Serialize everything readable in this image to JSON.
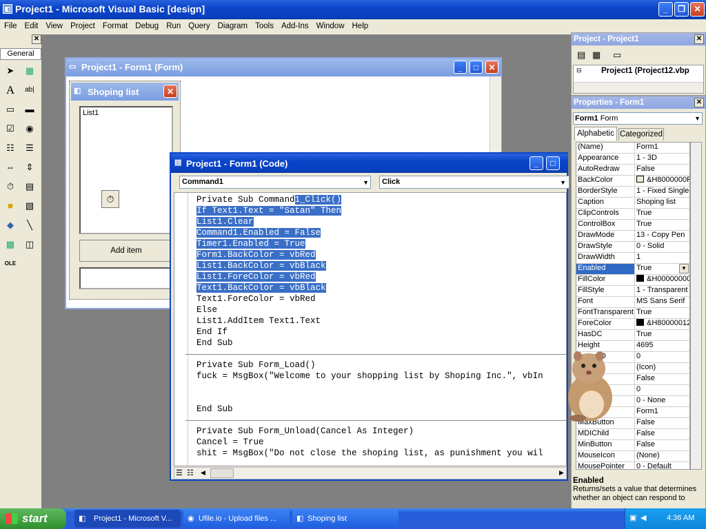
{
  "main_window": {
    "title": "Project1 - Microsoft Visual Basic [design]"
  },
  "menu": [
    "File",
    "Edit",
    "View",
    "Project",
    "Format",
    "Debug",
    "Run",
    "Query",
    "Diagram",
    "Tools",
    "Add-Ins",
    "Window",
    "Help"
  ],
  "toolbox": {
    "tab": "General"
  },
  "form_designer": {
    "title": "Project1 - Form1 (Form)"
  },
  "form1": {
    "title": "Shoping list",
    "list_label": "List1",
    "button_label": "Add item"
  },
  "code_window": {
    "title": "Project1 - Form1 (Code)",
    "object_dropdown": "Command1",
    "proc_dropdown": "Click",
    "sections": [
      [
        {
          "pre": "Private Sub Command",
          "sel": "1_Click()"
        },
        {
          "pre": "",
          "sel": "If Text1.Text = \"Satan\" Then"
        },
        {
          "pre": "",
          "sel": "List1.Clear"
        },
        {
          "pre": "",
          "sel": "Command1.Enabled = False"
        },
        {
          "pre": "",
          "sel": "Timer1.Enabled = True"
        },
        {
          "pre": "",
          "sel": "Form1.BackColor = vbRed"
        },
        {
          "pre": "",
          "sel": "List1.BackColor = vbBlack"
        },
        {
          "pre": "",
          "sel": "List1.ForeColor = vbRed"
        },
        {
          "pre": "",
          "sel": "Text1.BackColor = vbBlack"
        },
        {
          "pre": "Text1.ForeColor = vbRed",
          "sel": ""
        },
        {
          "pre": "Else",
          "sel": ""
        },
        {
          "pre": "List1.AddItem Text1.Text",
          "sel": ""
        },
        {
          "pre": "End If",
          "sel": ""
        },
        {
          "pre": "End Sub",
          "sel": ""
        }
      ],
      [
        {
          "pre": "Private Sub Form_Load()",
          "sel": ""
        },
        {
          "pre": "fuck = MsgBox(\"Welcome to your shopping list by Shoping Inc.\", vbIn",
          "sel": ""
        },
        {
          "pre": "",
          "sel": ""
        },
        {
          "pre": "",
          "sel": ""
        },
        {
          "pre": "End Sub",
          "sel": ""
        }
      ],
      [
        {
          "pre": "Private Sub Form_Unload(Cancel As Integer)",
          "sel": ""
        },
        {
          "pre": "Cancel = True",
          "sel": ""
        },
        {
          "pre": "shit = MsgBox(\"Do not close the shoping list, as punishment you wil",
          "sel": ""
        }
      ]
    ]
  },
  "project_panel": {
    "title": "Project - Project1",
    "tree_item": "Project1 (Project12.vbp"
  },
  "properties_panel": {
    "title": "Properties - Form1",
    "object_name": "Form1",
    "object_type": "Form",
    "tabs": [
      "Alphabetic",
      "Categorized"
    ],
    "rows": [
      {
        "k": "(Name)",
        "v": "Form1"
      },
      {
        "k": "Appearance",
        "v": "1 - 3D"
      },
      {
        "k": "AutoRedraw",
        "v": "False"
      },
      {
        "k": "BackColor",
        "v": "&H8000000F",
        "swatch": "#ece9d8"
      },
      {
        "k": "BorderStyle",
        "v": "1 - Fixed Single"
      },
      {
        "k": "Caption",
        "v": "Shoping list"
      },
      {
        "k": "ClipControls",
        "v": "True"
      },
      {
        "k": "ControlBox",
        "v": "True"
      },
      {
        "k": "DrawMode",
        "v": "13 - Copy Pen"
      },
      {
        "k": "DrawStyle",
        "v": "0 - Solid"
      },
      {
        "k": "DrawWidth",
        "v": "1"
      },
      {
        "k": "Enabled",
        "v": "True",
        "selected": true
      },
      {
        "k": "FillColor",
        "v": "&H00000000",
        "swatch": "#000000"
      },
      {
        "k": "FillStyle",
        "v": "1 - Transparent"
      },
      {
        "k": "Font",
        "v": "MS Sans Serif"
      },
      {
        "k": "FontTransparent",
        "v": "True"
      },
      {
        "k": "ForeColor",
        "v": "&H80000012",
        "swatch": "#000000"
      },
      {
        "k": "HasDC",
        "v": "True"
      },
      {
        "k": "Height",
        "v": "4695"
      },
      {
        "k": "ontextID",
        "v": "0"
      },
      {
        "k": "",
        "v": "(Icon)"
      },
      {
        "k": "w",
        "v": "False"
      },
      {
        "k": "",
        "v": "0"
      },
      {
        "k": "",
        "v": "0 - None"
      },
      {
        "k": "",
        "v": "Form1"
      },
      {
        "k": "MaxButton",
        "v": "False"
      },
      {
        "k": "MDIChild",
        "v": "False"
      },
      {
        "k": "MinButton",
        "v": "False"
      },
      {
        "k": "MouseIcon",
        "v": "(None)"
      },
      {
        "k": "MousePointer",
        "v": "0 - Default"
      }
    ],
    "desc_title": "Enabled",
    "desc_text": "Returns/sets a value that determines whether an object can respond to"
  },
  "taskbar": {
    "start": "start",
    "items": [
      "Project1 - Microsoft V...",
      "Ufile.io - Upload files ...",
      "Shoping list"
    ],
    "clock": "4:36 AM"
  }
}
